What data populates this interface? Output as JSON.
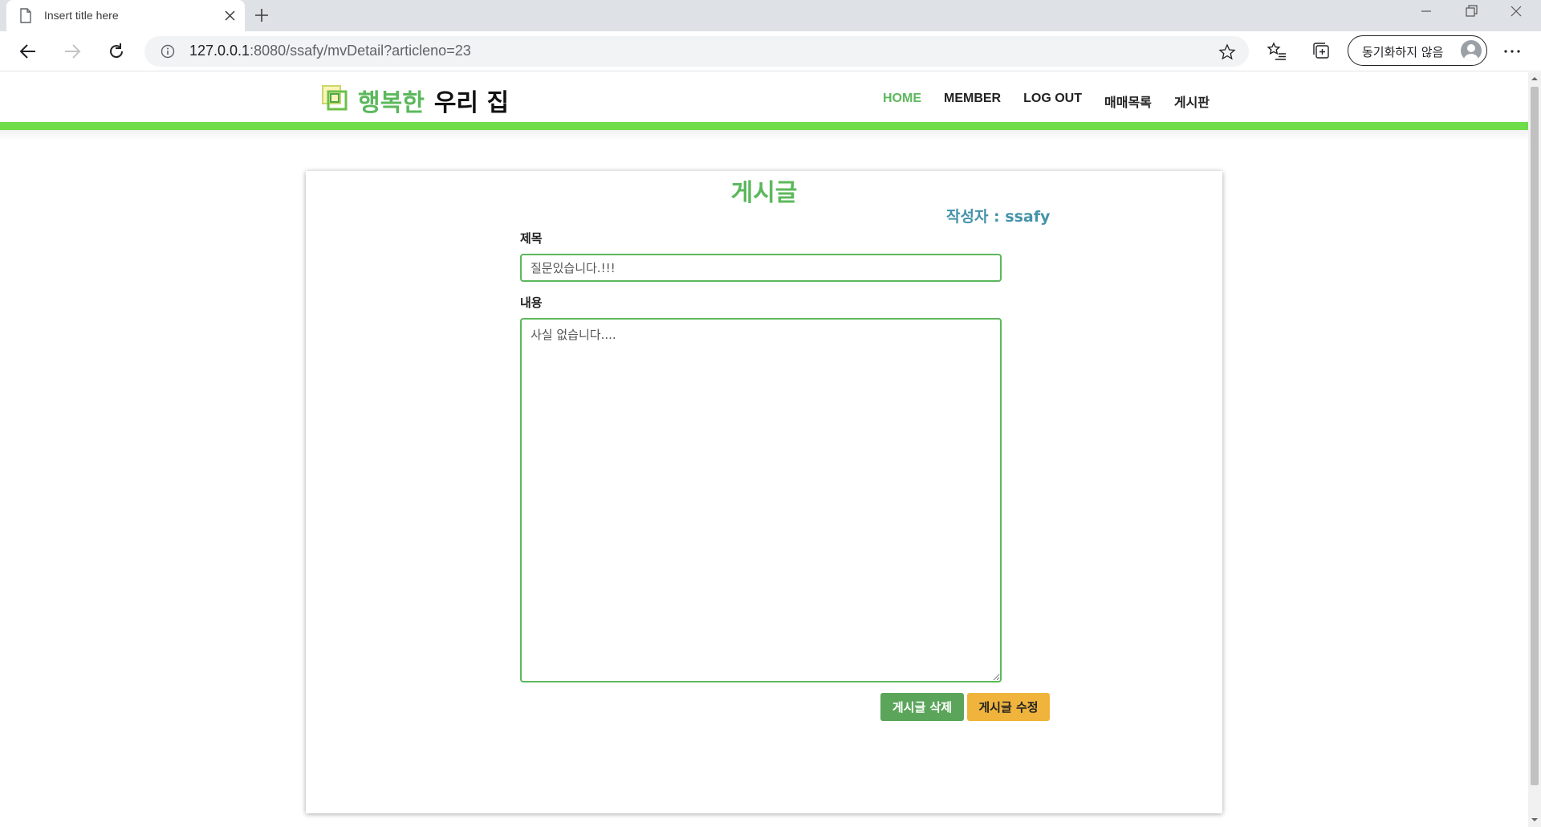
{
  "browser": {
    "tab_title": "Insert title here",
    "url_host": "127.0.0.1",
    "url_path": ":8080/ssafy/mvDetail?articleno=23",
    "sync_label": "동기화하지 않음"
  },
  "site": {
    "logo_part1": "행복한",
    "logo_part2": "우리 집",
    "nav": [
      "HOME",
      "MEMBER",
      "LOG OUT",
      "매매목록",
      "게시판"
    ],
    "accent_color": "#5cb85c",
    "bar_color": "#6fdc4a"
  },
  "article": {
    "heading": "게시글",
    "author_line": "작성자 : ssafy",
    "title_label": "제목",
    "title_value": "질문있습니다.!!!",
    "content_label": "내용",
    "content_value": "사실 없습니다....",
    "delete_button": "게시글 삭제",
    "edit_button": "게시글 수정"
  }
}
